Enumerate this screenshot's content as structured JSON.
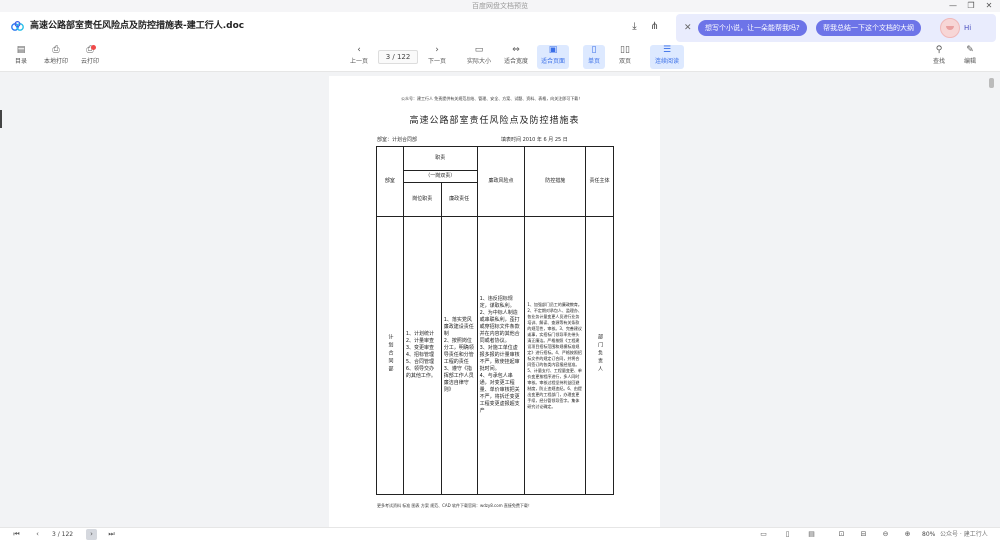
{
  "window": {
    "title": "百度网盘文档预览"
  },
  "header": {
    "doc_title": "高速公路部室责任风险点及防控措施表-建工行人.doc"
  },
  "ai": {
    "chip1": "想写个小说，让一朵能帮我吗?",
    "chip2": "帮我总结一下这个文档的大纲",
    "greeting": "Hi"
  },
  "toolbar": {
    "catalog": "目录",
    "local_print": "本地打印",
    "cloud_print": "云打印",
    "prev_page": "上一页",
    "page_indicator": "3 / 122",
    "next_page": "下一页",
    "actual_size": "实际大小",
    "fit_width": "适合宽度",
    "fit_page": "适合页面",
    "single_page": "单页",
    "double_page": "双页",
    "continuous": "连续阅读",
    "find": "查找",
    "edit": "编辑"
  },
  "document": {
    "top_note": "公众号：建工行人  免责提供有关规范总结、管理、安全、方案、试题、资料、表格，向关注即可下载！",
    "title": "高速公路部室责任风险点及防控措施表",
    "dept": "部室：计划合同部",
    "date": "填表时间   2010   年  6  月  25  日",
    "table": {
      "h_dept": "部室",
      "h_duty": "职责",
      "h_duty_sub": "（一岗双责）",
      "h_post": "岗位职责",
      "h_clean": "廉政责任",
      "h_risk": "廉政风险点",
      "h_measure": "防控措施",
      "h_owner": "责任主体",
      "dept": "计划合同部",
      "post": "1、计划统计\n2、计量审查\n3、变更审查\n4、招标管理\n5、合同管理\n6、领导交办的其他工作。",
      "clean": "1、落实党风廉政建设责任制\n2、按照岗位分工，明确领导责任和分管工程的责任\n3、遵守《指挥部工作人员廉洁自律守则》",
      "risk": "1、违反招标规定，谋取私利。\n2、为中标人制造或串联私利，歪打或穿招标文件条款并在内容的其他合同或者协议。\n3、对施工单位虚报多报的计量审核不严，致使挂起审批时间。\n4、与承包人串通，对变更工程量、单价审核把关不严，将拆迁变更工程变更虚报超支产",
      "measure": "1、加强部门员工的廉政教育。2、不定期对承包人、监理办、各业务计量变更人员进行业务培训、解读、查源等有关条款的规范性，审核。3、完善建议或事，实招标门领导率先带头清正廉洁。严格按照《工程建设项目招标范围和规模标准规定》进行招标。4、严格按照招标文件的规定订合同，并将合同签订的各类内容报经批准。5、计量支付、工程量变更、单价变更按程序进行，多人同时审核。审核过程坚持利益回避制度，防止违规违纪。6、由提出变更的工程部门，办理变更手续，经分管领导签字。集体研究讨论确定。",
      "owner": "部门负责人"
    },
    "footer": "更多考试资料 标准 图表 方案 规范、CAD 软件下载官网：wdzy8.com 直接免费下载！"
  },
  "status": {
    "page_indicator": "3 / 122",
    "zoom": "80%",
    "brand": "公众号 · 建工行人"
  }
}
